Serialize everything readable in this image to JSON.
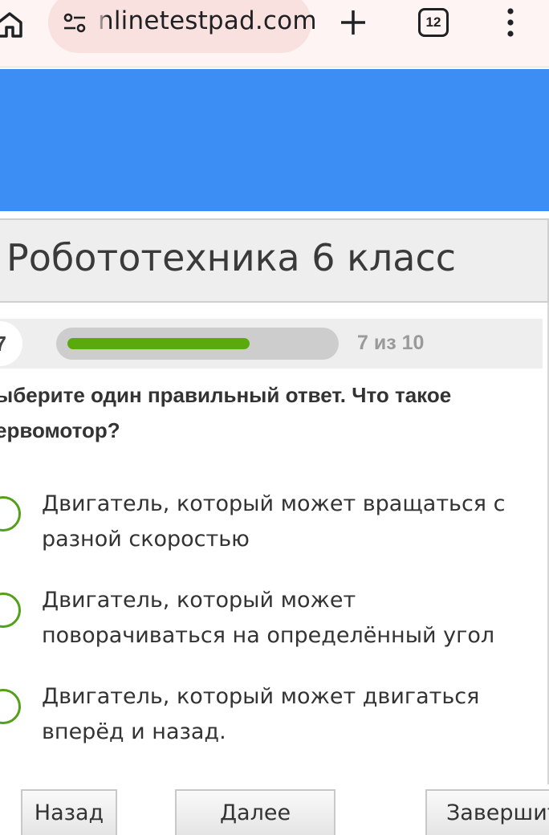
{
  "browser": {
    "url": "nlinetestpad.com",
    "tab_count": "12",
    "icons": {
      "home": "home-icon",
      "site_settings": "tune-icon",
      "new_tab": "plus-icon",
      "menu": "more-vert-icon"
    }
  },
  "page": {
    "title": "Робототехника 6 класс",
    "accent_color": "#3c8ef5",
    "progress_color": "#5aaa0e"
  },
  "progress": {
    "current_question": "7",
    "label": "7 из 10",
    "fraction": 0.7
  },
  "question": {
    "text": "ыберите один правильный ответ. Что такое ервомотор?"
  },
  "options": [
    {
      "label": "Двигатель, который может вращаться с разной скоростью"
    },
    {
      "label": "Двигатель, который может поворачиваться на определённый угол"
    },
    {
      "label": "Двигатель, который может двигаться вперёд и назад."
    }
  ],
  "buttons": {
    "back": "Назад",
    "next": "Далее",
    "finish": "Завершит"
  }
}
